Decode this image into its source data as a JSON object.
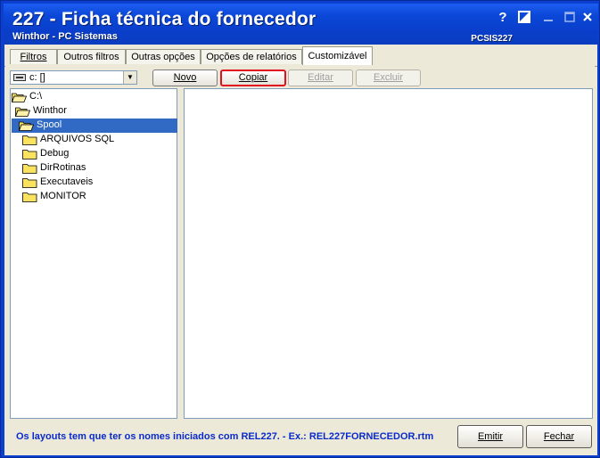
{
  "window": {
    "title": "227 - Ficha técnica do fornecedor",
    "subtitle": "Winthor - PC Sistemas",
    "code": "PCSIS227",
    "help_glyph": "?"
  },
  "tabs": [
    {
      "label": "Filtros",
      "active": false
    },
    {
      "label": "Outros filtros",
      "active": false
    },
    {
      "label": "Outras opções",
      "active": false
    },
    {
      "label": "Opções de relatórios",
      "active": false
    },
    {
      "label": "Customizável",
      "active": true
    }
  ],
  "toolbar": {
    "drive_value": "c: []",
    "novo_label": "Novo",
    "copiar_label": "Copiar",
    "editar_label": "Editar",
    "excluir_label": "Excluir"
  },
  "tree": [
    {
      "label": "C:\\",
      "level": 0,
      "open": true,
      "selected": false
    },
    {
      "label": "Winthor",
      "level": 1,
      "open": true,
      "selected": false
    },
    {
      "label": "Spool",
      "level": 2,
      "open": true,
      "selected": true
    },
    {
      "label": "ARQUIVOS SQL",
      "level": 3,
      "open": false,
      "selected": false
    },
    {
      "label": "Debug",
      "level": 3,
      "open": false,
      "selected": false
    },
    {
      "label": "DirRotinas",
      "level": 3,
      "open": false,
      "selected": false
    },
    {
      "label": "Executaveis",
      "level": 3,
      "open": false,
      "selected": false
    },
    {
      "label": "MONITOR",
      "level": 3,
      "open": false,
      "selected": false
    }
  ],
  "footer": {
    "hint": "Os layouts tem que ter os nomes iniciados com REL227.  - Ex.: REL227FORNECEDOR.rtm",
    "emitir_label": "Emitir",
    "fechar_label": "Fechar"
  },
  "colors": {
    "title_bar": "#0a3ec9",
    "selection": "#316ac5",
    "hint_text": "#0a2bcc",
    "highlight_border": "#e01020",
    "folder": "#f8e260"
  }
}
